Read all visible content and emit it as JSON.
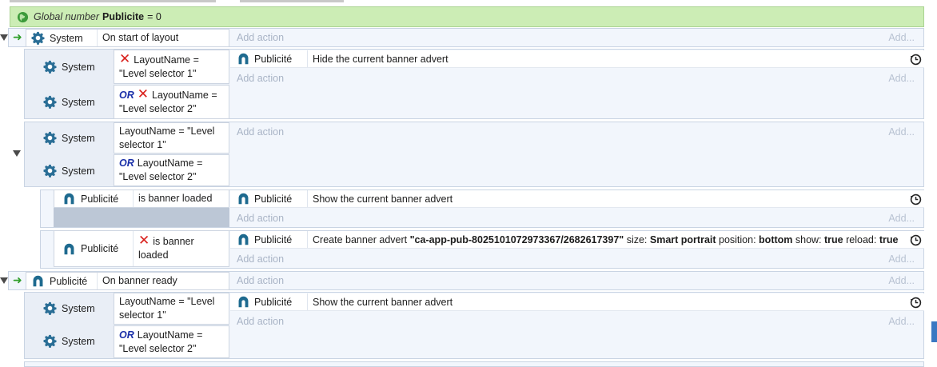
{
  "global_var": {
    "prefix": "Global number",
    "name": "Publicite",
    "suffix": "= 0"
  },
  "add_action": "Add action",
  "add_ellipsis": "Add...",
  "events": {
    "e1": {
      "cond_object": "System",
      "cond_text": "On start of layout"
    },
    "e2": {
      "c1_object": "System",
      "c1_text": "LayoutName = \"Level selector 1\"",
      "c2_object": "System",
      "c2_or": "OR",
      "c2_text": "LayoutName = \"Level selector 2\"",
      "a1_object": "Publicité",
      "a1_text": "Hide the current banner advert"
    },
    "e3": {
      "c1_object": "System",
      "c1_text": "LayoutName = \"Level selector 1\"",
      "c2_object": "System",
      "c2_or": "OR",
      "c2_text": "LayoutName = \"Level selector 2\""
    },
    "e4": {
      "c1_object": "Publicité",
      "c1_text": "is banner loaded",
      "a1_object": "Publicité",
      "a1_text": "Show the current banner advert"
    },
    "e5": {
      "c1_object": "Publicité",
      "c1_text": "is banner loaded",
      "a1_object": "Publicité",
      "a1_parts": [
        "Create banner advert ",
        "\"ca-app-pub-8025101072973367/2682617397\"",
        " size: ",
        "Smart portrait",
        " position: ",
        "bottom",
        " show: ",
        "true",
        " reload: ",
        "true"
      ]
    },
    "e6": {
      "cond_object": "Publicité",
      "cond_text": "On banner ready"
    },
    "e7": {
      "c1_object": "System",
      "c1_text": "LayoutName = \"Level selector 1\"",
      "c2_object": "System",
      "c2_or": "OR",
      "c2_text": "LayoutName = \"Level selector 2\"",
      "a1_object": "Publicité",
      "a1_text": "Show the current banner advert"
    }
  },
  "colors": {
    "global_bg": "#ccedb5",
    "or_blue": "#1a2fa8",
    "invert_red": "#d9201c",
    "add_action_gray": "#a9b4c6"
  },
  "icons": [
    "globe-icon",
    "gear-icon",
    "publicite-icon",
    "invert-x-icon",
    "trigger-arrow-icon",
    "collapse-triangle-icon",
    "clock-icon"
  ]
}
